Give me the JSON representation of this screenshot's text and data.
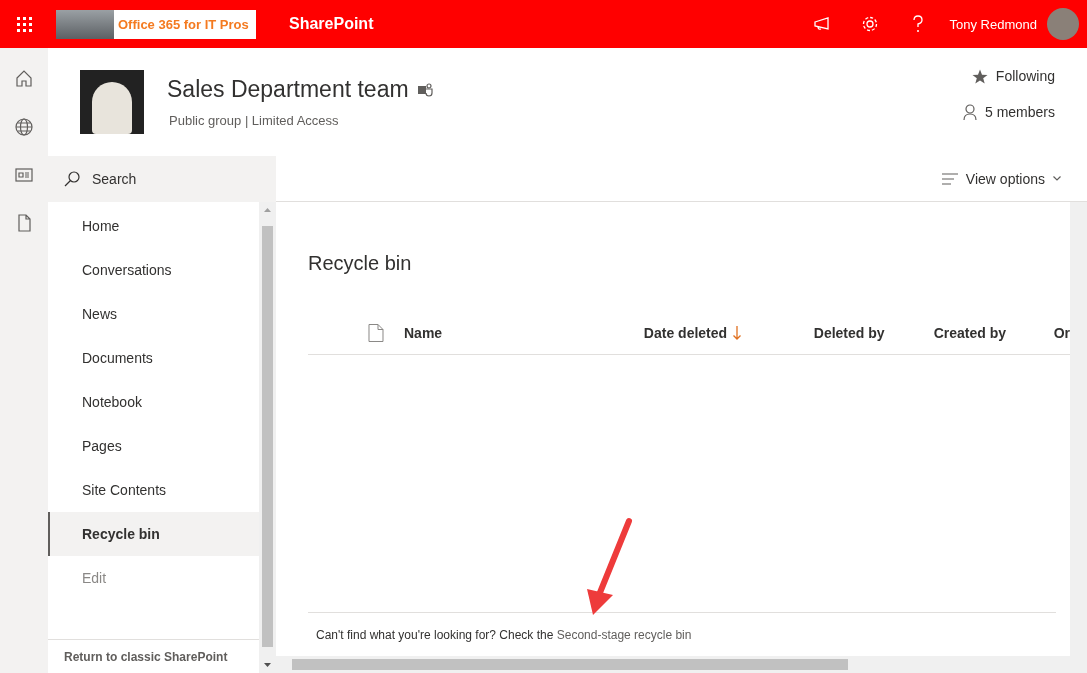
{
  "top_bar": {
    "logo_text": "Office 365 for IT Pros",
    "app_name": "SharePoint",
    "user_name": "Tony Redmond"
  },
  "site": {
    "title": "Sales Department team",
    "subtitle": "Public group | Limited Access",
    "following": "Following",
    "members": "5 members"
  },
  "search": {
    "placeholder": "Search"
  },
  "command_bar": {
    "view_options": "View options"
  },
  "nav": {
    "items": [
      {
        "label": "Home",
        "selected": false
      },
      {
        "label": "Conversations",
        "selected": false
      },
      {
        "label": "News",
        "selected": false
      },
      {
        "label": "Documents",
        "selected": false
      },
      {
        "label": "Notebook",
        "selected": false
      },
      {
        "label": "Pages",
        "selected": false
      },
      {
        "label": "Site Contents",
        "selected": false
      },
      {
        "label": "Recycle bin",
        "selected": true
      }
    ],
    "edit": "Edit",
    "footer": "Return to classic SharePoint"
  },
  "page": {
    "title": "Recycle bin",
    "columns": [
      {
        "label": "Name",
        "sorted": false
      },
      {
        "label": "Date deleted",
        "sorted": true
      },
      {
        "label": "Deleted by",
        "sorted": false
      },
      {
        "label": "Created by",
        "sorted": false
      },
      {
        "label": "Or",
        "sorted": false
      }
    ],
    "footer_text": "Can't find what you're looking for? Check the ",
    "footer_link": "Second-stage recycle bin"
  }
}
